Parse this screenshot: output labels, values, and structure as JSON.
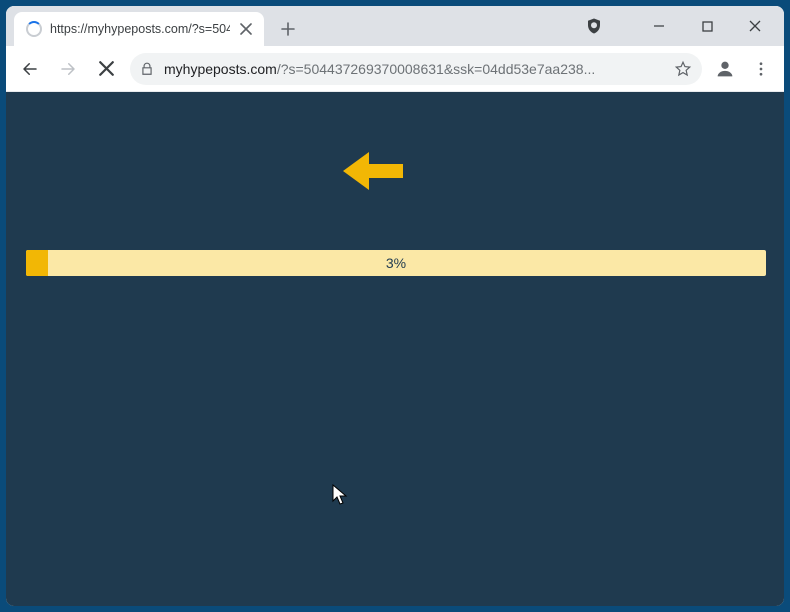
{
  "tab": {
    "title": "https://myhypeposts.com/?s=504"
  },
  "url": {
    "host": "myhypeposts.com",
    "path": "/?s=504437269370008631&ssk=04dd53e7aa238..."
  },
  "progress": {
    "percent": 3,
    "label": "3%"
  },
  "colors": {
    "page_bg": "#1f3a4f",
    "accent": "#f2b705",
    "progress_bg": "#fbe8a6"
  }
}
